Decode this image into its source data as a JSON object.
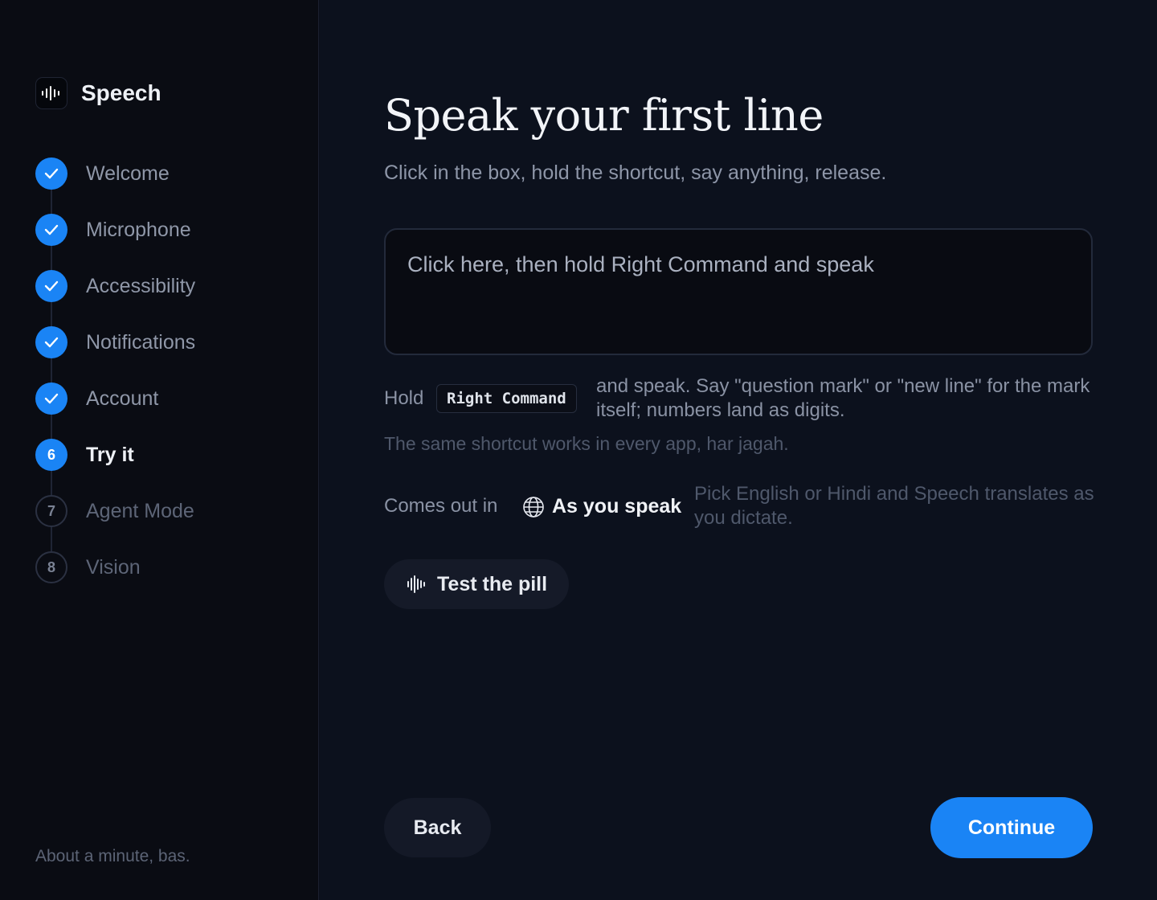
{
  "brand": {
    "name": "Speech",
    "icon": "waveform-icon"
  },
  "steps": [
    {
      "label": "Welcome",
      "state": "done",
      "marker": ""
    },
    {
      "label": "Microphone",
      "state": "done",
      "marker": ""
    },
    {
      "label": "Accessibility",
      "state": "done",
      "marker": ""
    },
    {
      "label": "Notifications",
      "state": "done",
      "marker": ""
    },
    {
      "label": "Account",
      "state": "done",
      "marker": ""
    },
    {
      "label": "Try it",
      "state": "current",
      "marker": "6"
    },
    {
      "label": "Agent Mode",
      "state": "future",
      "marker": "7"
    },
    {
      "label": "Vision",
      "state": "future",
      "marker": "8"
    }
  ],
  "sidebar_footer": "About a minute, bas.",
  "main": {
    "title": "Speak your first line",
    "subtitle": "Click in the box, hold the shortcut, say anything, release.",
    "dictation_placeholder": "Click here, then hold Right Command and speak",
    "hold_word": "Hold",
    "shortcut_key": "Right Command",
    "hold_description": "and speak. Say \"question mark\" or \"new line\" for the mark itself; numbers land as digits.",
    "hint": "The same shortcut works in every app, har jagah.",
    "comes_out_label": "Comes out in",
    "language_option": "As you speak",
    "language_note": "Pick English or Hindi and Speech translates as you dictate.",
    "test_pill_label": "Test the pill",
    "back_label": "Back",
    "continue_label": "Continue"
  },
  "colors": {
    "accent": "#1a84f5",
    "background": "#0c111d",
    "sidebar": "#0a0c13"
  }
}
